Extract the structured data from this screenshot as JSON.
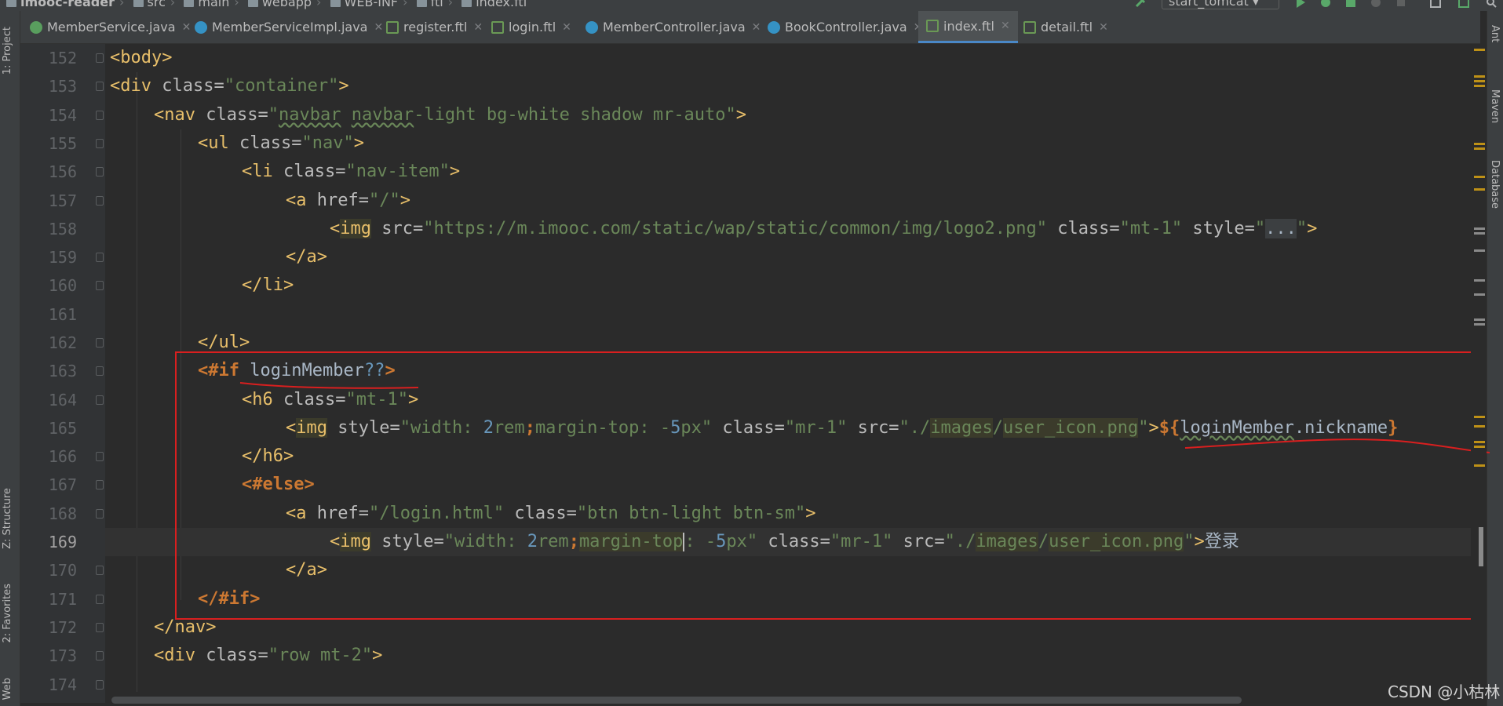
{
  "breadcrumb": [
    "imooc-reader",
    "src",
    "main",
    "webapp",
    "WEB-INF",
    "ftl",
    "index.ftl"
  ],
  "run_config": "start_tomcat",
  "tabs": [
    {
      "label": "MemberService.java",
      "icon": "interface-icon"
    },
    {
      "label": "MemberServiceImpl.java",
      "icon": "class-icon"
    },
    {
      "label": "register.ftl",
      "icon": "ftl-file-icon"
    },
    {
      "label": "login.ftl",
      "icon": "ftl-file-icon"
    },
    {
      "label": "MemberController.java",
      "icon": "class-icon"
    },
    {
      "label": "BookController.java",
      "icon": "class-icon"
    },
    {
      "label": "index.ftl",
      "icon": "ftl-file-icon",
      "active": true
    },
    {
      "label": "detail.ftl",
      "icon": "ftl-file-icon"
    }
  ],
  "left_tools": [
    "1: Project",
    "Z: Structure",
    "2: Favorites",
    "Web"
  ],
  "right_tools": [
    "Ant",
    "Maven",
    "Database"
  ],
  "line_numbers": [
    "152",
    "153",
    "154",
    "155",
    "156",
    "157",
    "158",
    "159",
    "160",
    "161",
    "162",
    "163",
    "164",
    "165",
    "166",
    "167",
    "168",
    "169",
    "170",
    "171",
    "172",
    "173",
    "174"
  ],
  "current_line": "169",
  "code": {
    "l152": {
      "t1": "<body>"
    },
    "l153": {
      "t1": "<div ",
      "a1": "class=",
      "s1": "\"container\"",
      "t2": ">"
    },
    "l154": {
      "t1": "<nav ",
      "a1": "class=",
      "s1a": "\"",
      "s1b": "navbar",
      "s1c": " ",
      "s1d": "navbar",
      "s1e": "-light bg-white shadow mr-auto\"",
      "t2": ">"
    },
    "l155": {
      "t1": "<ul ",
      "a1": "class=",
      "s1": "\"nav\"",
      "t2": ">"
    },
    "l156": {
      "t1": "<li ",
      "a1": "class=",
      "s1": "\"nav-item\"",
      "t2": ">"
    },
    "l157": {
      "t1": "<a ",
      "a1": "href=",
      "s1": "\"/\"",
      "t2": ">"
    },
    "l158": {
      "t0": "<",
      "t1": "img",
      "a1": " src=",
      "s1": "\"https://m.imooc.com/static/wap/static/common/img/logo2.png\"",
      "a2": " class=",
      "s2": "\"mt-1\"",
      "a3": " style=",
      "s3a": "\"",
      "s3b": "...",
      "s3c": "\"",
      "t2": ">"
    },
    "l159": {
      "t1": "</a>"
    },
    "l160": {
      "t1": "</li>"
    },
    "l162": {
      "t1": "</ul>"
    },
    "l163": {
      "k1": "<#if ",
      "p1": "loginMember",
      "n1": "??",
      "k2": ">"
    },
    "l164": {
      "t1": "<h6 ",
      "a1": "class=",
      "s1": "\"mt-1\"",
      "t2": ">"
    },
    "l165": {
      "t0": "<",
      "t1": "img",
      "a1": " style=",
      "s1a": "\"width: ",
      "n1": "2",
      "s1b": "rem",
      "k1": ";",
      "s1c": "margin-top: -",
      "n2": "5",
      "s1d": "px\"",
      "a2": " class=",
      "s2": "\"mr-1\"",
      "a3": " src=",
      "s3a": "\"./",
      "s3b": "images",
      "s3c": "/",
      "s3d": "user_icon.png",
      "s3e": "\"",
      "t2": ">",
      "k2": "${",
      "p1": "loginMember",
      "p2": ".nickname",
      "k3": "}"
    },
    "l166": {
      "t1": "</h6>"
    },
    "l167": {
      "k1": "<#else>"
    },
    "l168": {
      "t1": "<a ",
      "a1": "href=",
      "s1": "\"/login.html\"",
      "a2": " class=",
      "s2": "\"btn btn-light btn-sm\"",
      "t2": ">"
    },
    "l169": {
      "t0": "<",
      "t1": "img",
      "a1": " style=",
      "s1a": "\"width: ",
      "n1": "2",
      "s1b": "rem",
      "k1": ";",
      "s1c": "margin-top",
      "s1d": ": -",
      "n2": "5",
      "s1e": "px\"",
      "a2": " class=",
      "s2": "\"mr-1\"",
      "a3": " src=",
      "s3a": "\"./",
      "s3b": "images",
      "s3c": "/",
      "s3d": "user_icon.png",
      "s3e": "\"",
      "t2": ">",
      "p1": "登录"
    },
    "l170": {
      "t1": "</a>"
    },
    "l171": {
      "k1": "</#if>"
    },
    "l172": {
      "t1": "</nav>"
    },
    "l173": {
      "t1": "<div ",
      "a1": "class=",
      "s1": "\"row mt-2\"",
      "t2": ">"
    }
  },
  "watermark": "CSDN @小枯林",
  "colors": {
    "annotation": "#d91f1f",
    "active_tab_underline": "#4a88c7",
    "editor_bg": "#2b2b2b"
  }
}
